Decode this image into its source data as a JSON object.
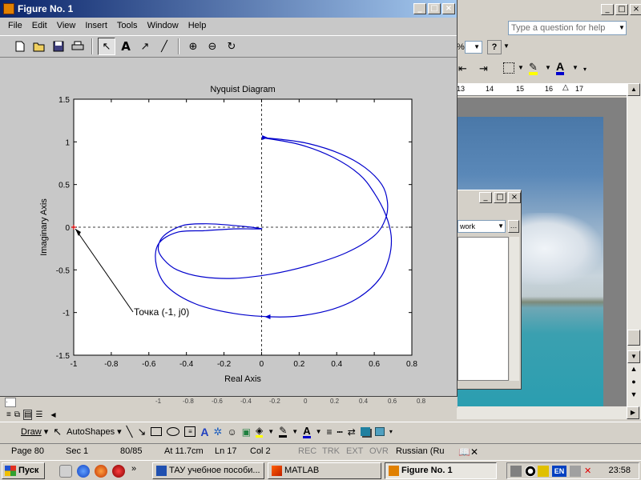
{
  "word": {
    "help_placeholder": "Type a question for help",
    "zoom_suffix": "%",
    "ruler_ticks": [
      "13",
      "14",
      "15",
      "16",
      "17"
    ],
    "draw_label": "Draw",
    "autoshapes_label": "AutoShapes",
    "status": {
      "page": "Page 80",
      "sec": "Sec 1",
      "pages": "80/85",
      "at": "At 11.7cm",
      "ln": "Ln 17",
      "col": "Col 2",
      "rec": "REC",
      "trk": "TRK",
      "ext": "EXT",
      "ovr": "OVR",
      "lang": "Russian (Ru"
    }
  },
  "workspace_dialog": {
    "combo_value": "work"
  },
  "figure": {
    "title": "Figure No. 1",
    "menu": [
      "File",
      "Edit",
      "View",
      "Insert",
      "Tools",
      "Window",
      "Help"
    ],
    "toolbar_icons": [
      "new-file-icon",
      "open-folder-icon",
      "save-icon",
      "print-icon",
      "select-arrow-icon",
      "text-icon",
      "arrow-icon",
      "line-icon",
      "zoom-in-icon",
      "zoom-out-icon",
      "rotate-icon"
    ],
    "bottom_ticks": [
      "-1",
      "-0.8",
      "-0.6",
      "-0.4",
      "-0.2",
      "0",
      "0.2",
      "0.4",
      "0.6",
      "0.8"
    ]
  },
  "chart_data": {
    "type": "line",
    "title": "Nyquist Diagram",
    "xlabel": "Real Axis",
    "ylabel": "Imaginary Axis",
    "xlim": [
      -1,
      0.8
    ],
    "ylim": [
      -1.5,
      1.5
    ],
    "xticks": [
      "-1",
      "-0.8",
      "-0.6",
      "-0.4",
      "-0.2",
      "0",
      "0.2",
      "0.4",
      "0.6",
      "0.8"
    ],
    "yticks": [
      "1.5",
      "1",
      "0.5",
      "0",
      "-0.5",
      "-1",
      "-1.5"
    ],
    "grid": false,
    "series": [
      {
        "color": "#0000cc",
        "x": [
          0.0,
          0.1,
          0.25,
          0.42,
          0.55,
          0.64,
          0.67,
          0.66,
          0.6,
          0.45,
          0.25,
          0.05,
          -0.15,
          -0.32,
          -0.45,
          -0.52,
          -0.55,
          -0.52,
          -0.42,
          -0.3,
          -0.2,
          -0.1,
          -0.02,
          0.0,
          -0.05,
          -0.15,
          -0.3,
          -0.45,
          -0.55,
          -0.56,
          -0.5,
          -0.35,
          -0.15,
          0.05,
          0.2,
          0.38,
          0.52,
          0.63,
          0.68,
          0.69,
          0.66,
          0.6,
          0.52,
          0.38,
          0.2,
          0.0
        ],
        "y": [
          1.05,
          1.03,
          0.98,
          0.86,
          0.7,
          0.5,
          0.3,
          0.1,
          -0.1,
          -0.3,
          -0.45,
          -0.55,
          -0.6,
          -0.58,
          -0.5,
          -0.38,
          -0.25,
          -0.1,
          0.02,
          0.04,
          0.03,
          0.01,
          -0.01,
          -0.02,
          -0.02,
          -0.02,
          -0.04,
          -0.06,
          -0.2,
          -0.45,
          -0.7,
          -0.9,
          -1.01,
          -1.05,
          -1.04,
          -0.96,
          -0.82,
          -0.6,
          -0.35,
          -0.1,
          0.15,
          0.4,
          0.62,
          0.82,
          0.97,
          1.05
        ]
      }
    ],
    "annotation": {
      "text": "Точка (-1, j0)",
      "point": [
        -1,
        0
      ]
    }
  },
  "taskbar": {
    "start_label": "Пуск",
    "tasks": [
      {
        "label": "ТАУ учебное пособи...",
        "active": false
      },
      {
        "label": "MATLAB",
        "active": false
      },
      {
        "label": "Figure No. 1",
        "active": true
      }
    ],
    "tray_lang": "EN",
    "clock": "23:58"
  }
}
